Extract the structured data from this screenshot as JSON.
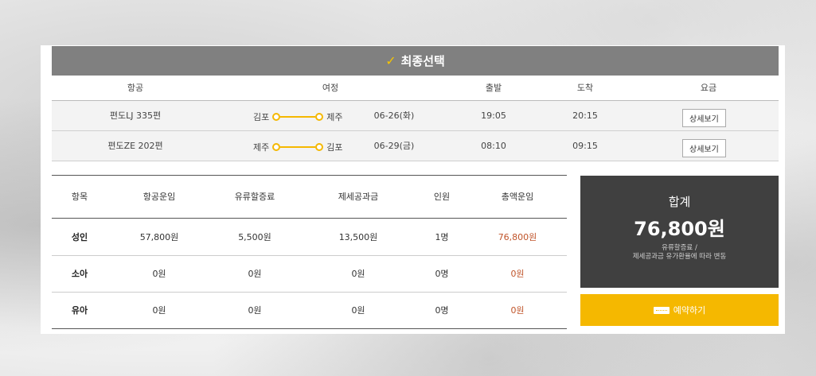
{
  "header": {
    "title": "최종선택"
  },
  "flights": {
    "columns": [
      "항공",
      "여정",
      "출발",
      "도착",
      "요금"
    ],
    "rows": [
      {
        "flight": "편도LJ 335편",
        "from": "김포",
        "to": "제주",
        "date": "06-26(화)",
        "depart": "19:05",
        "arrive": "20:15",
        "button": "상세보기"
      },
      {
        "flight": "편도ZE 202편",
        "from": "제주",
        "to": "김포",
        "date": "06-29(금)",
        "depart": "08:10",
        "arrive": "09:15",
        "button": "상세보기"
      }
    ]
  },
  "fares": {
    "columns": [
      "항목",
      "항공운임",
      "유류할증료",
      "제세공과금",
      "인원",
      "총액운임"
    ],
    "rows": [
      {
        "type": "성인",
        "air": "57,800원",
        "fuel": "5,500원",
        "tax": "13,500원",
        "count": "1명",
        "total": "76,800원"
      },
      {
        "type": "소아",
        "air": "0원",
        "fuel": "0원",
        "tax": "0원",
        "count": "0명",
        "total": "0원"
      },
      {
        "type": "유아",
        "air": "0원",
        "fuel": "0원",
        "tax": "0원",
        "count": "0명",
        "total": "0원"
      }
    ]
  },
  "summary": {
    "title": "합계",
    "amount": "76,800원",
    "note1": "유류할증료 /",
    "note2": "제세공과금 유가환율에 따라 변동"
  },
  "reserve": {
    "label": "예약하기",
    "icon": "ticket-icon"
  },
  "colors": {
    "accent": "#f5b800",
    "header_bg": "#808080",
    "total_bg": "#404040",
    "highlight": "#c0542a"
  }
}
